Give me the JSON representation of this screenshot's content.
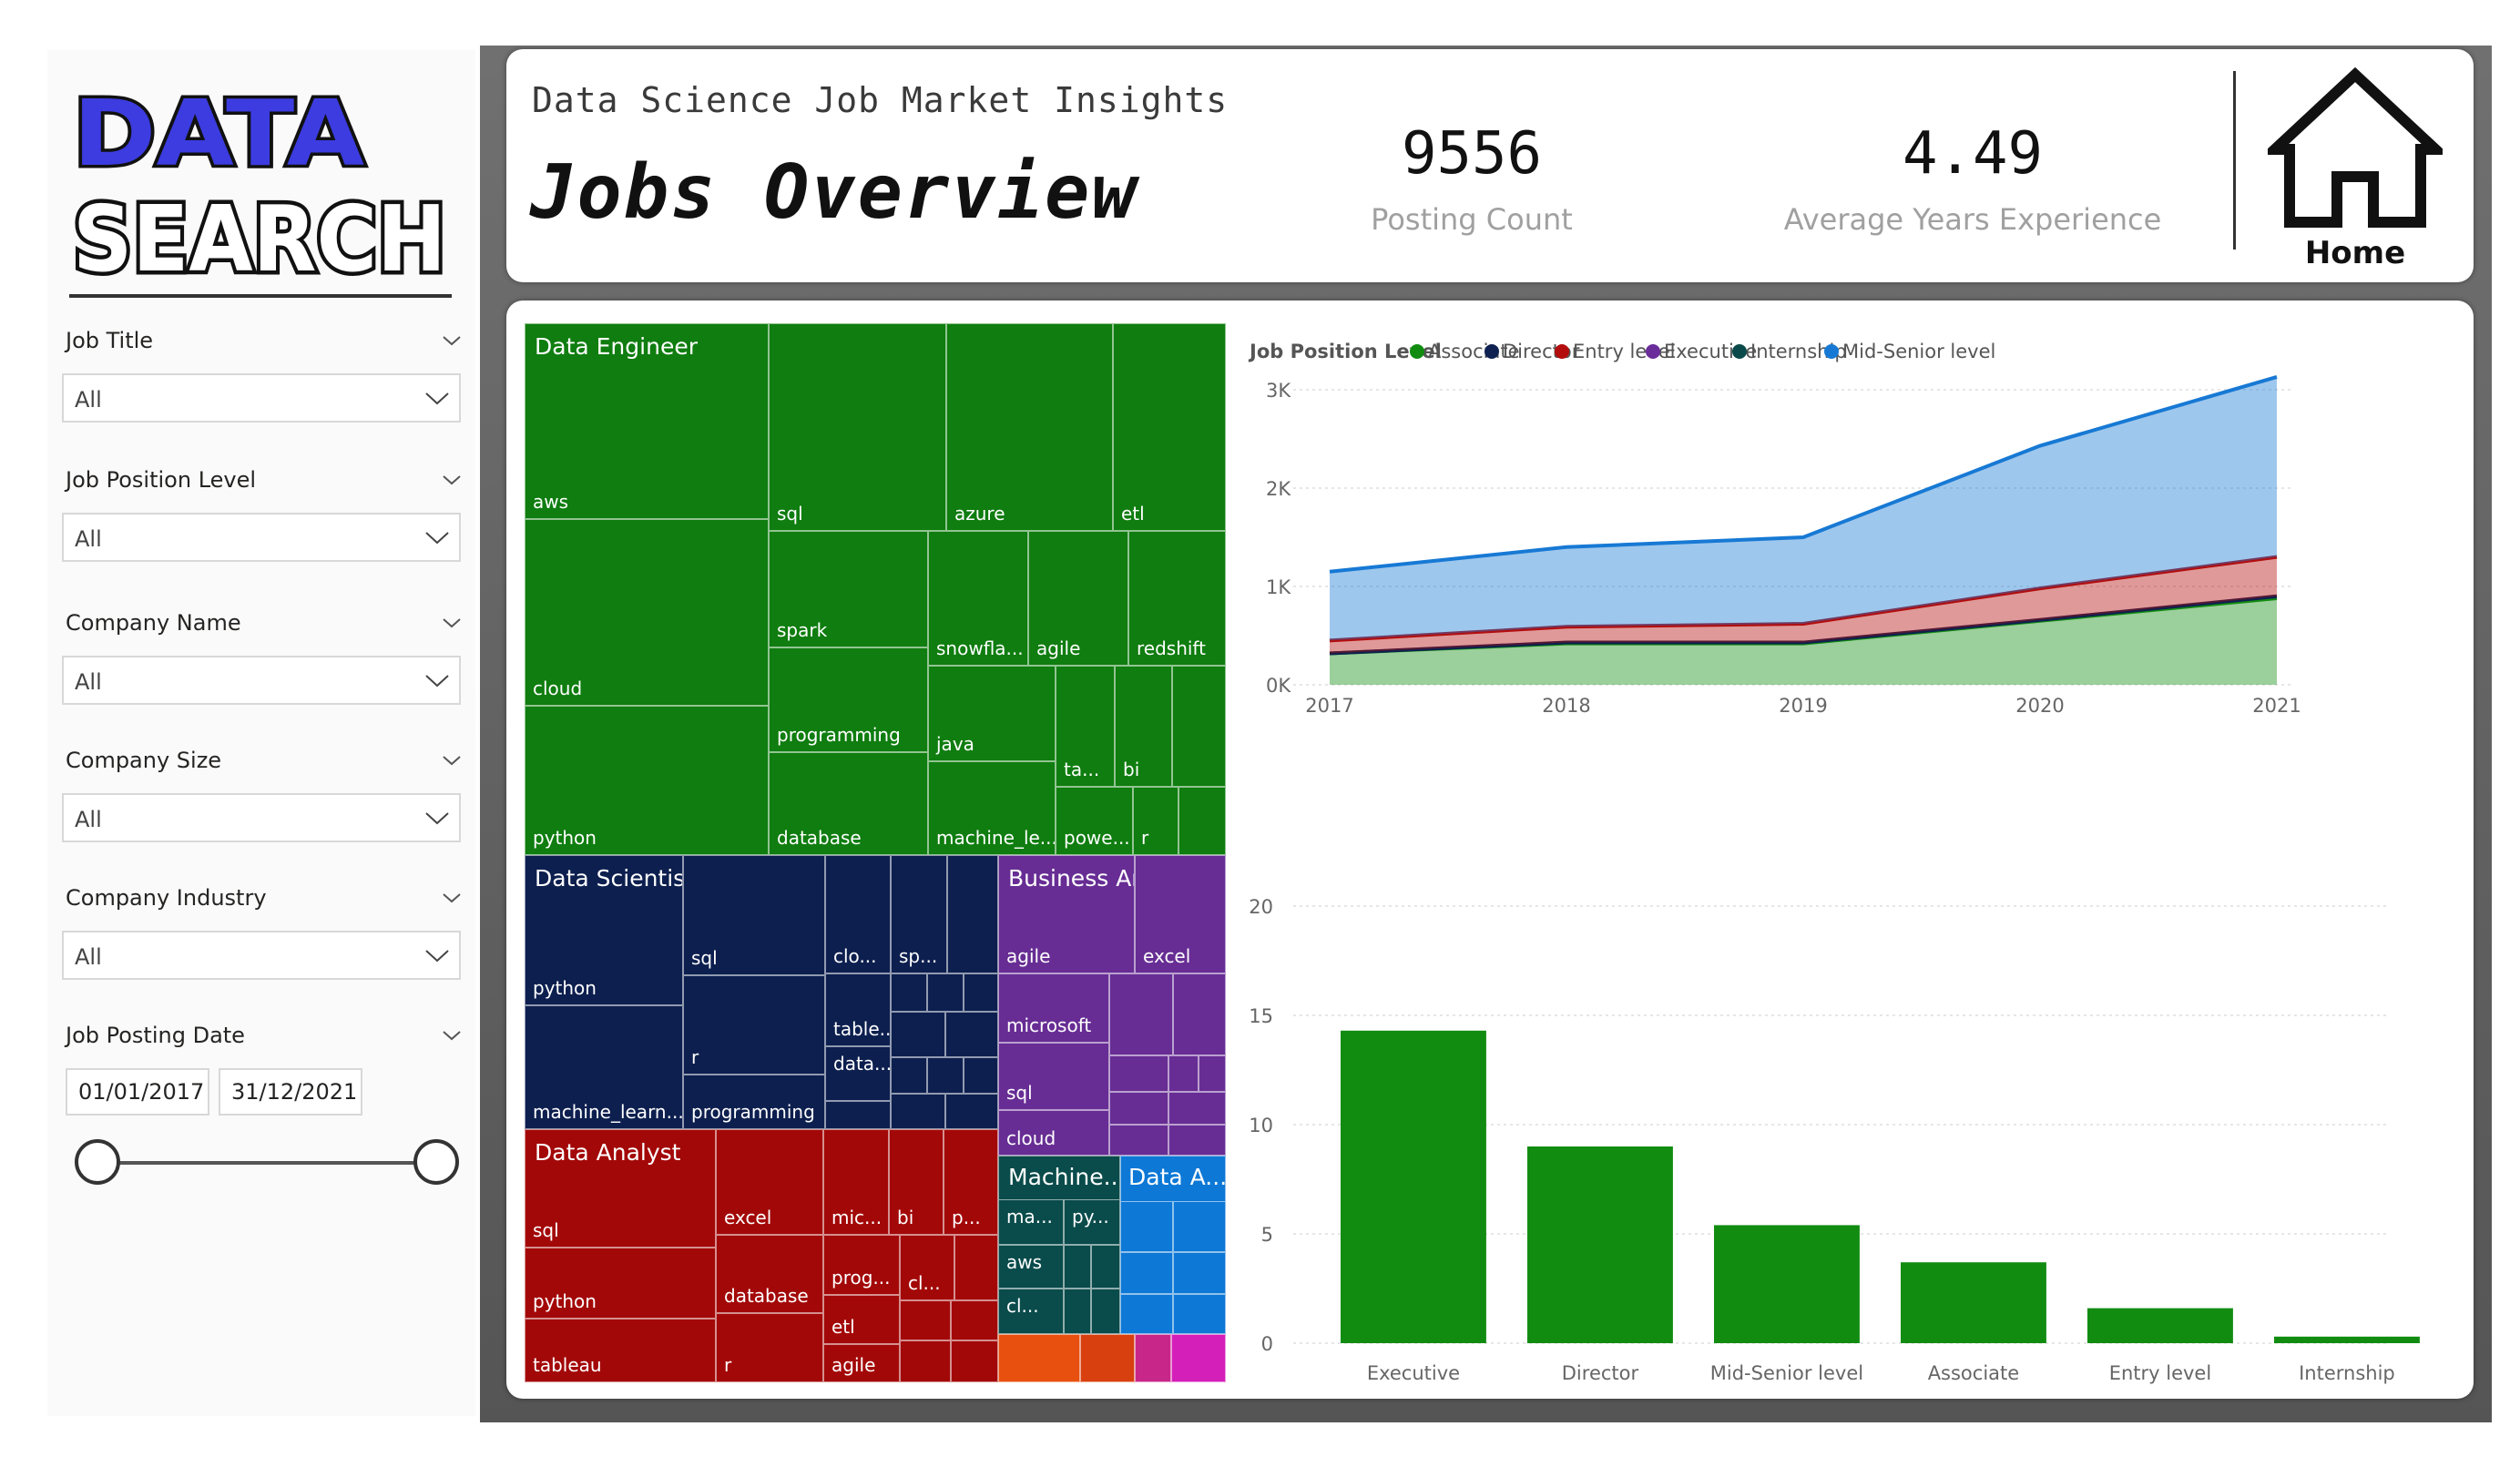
{
  "logo": {
    "line1": "DATA",
    "line2": "SEARCH"
  },
  "slicers": [
    {
      "label": "Job Title",
      "value": "All"
    },
    {
      "label": "Job Position Level",
      "value": "All"
    },
    {
      "label": "Company Name",
      "value": "All"
    },
    {
      "label": "Company Size",
      "value": "All"
    },
    {
      "label": "Company Industry",
      "value": "All"
    }
  ],
  "date_slicer": {
    "label": "Job Posting Date",
    "start": "01/01/2017",
    "end": "31/12/2021"
  },
  "header": {
    "subtitle": "Data Science Job Market Insights",
    "title": "Jobs Overview",
    "kpi1_value": "9556",
    "kpi1_label": "Posting Count",
    "kpi2_value": "4.49",
    "kpi2_label": "Average Years Experience",
    "home_label": "Home"
  },
  "colors": {
    "associate": "#118c11",
    "director": "#0e2150",
    "entry": "#b30d0d",
    "executive": "#6a2d9a",
    "internship": "#0b4a4a",
    "mid_senior": "#1779d4",
    "treemap_green": "#0f7d0f",
    "treemap_navy": "#0d1f4f",
    "treemap_purple": "#672d94",
    "treemap_red": "#a30808",
    "treemap_teal": "#0a4b4b",
    "treemap_blue": "#0d78d6"
  },
  "treemap": {
    "groups": [
      {
        "name": "Data Engineer",
        "items": [
          "aws",
          "cloud",
          "python",
          "sql",
          "azure",
          "etl",
          "spark",
          "snowfla...",
          "agile",
          "redshift",
          "programming",
          "java",
          "ta...",
          "bi",
          "database",
          "machine_le...",
          "powe...",
          "r"
        ]
      },
      {
        "name": "Data Scientist",
        "items": [
          "python",
          "machine_learn...",
          "sql",
          "r",
          "programming",
          "clo...",
          "sp...",
          "table...",
          "data..."
        ]
      },
      {
        "name": "Business Analyst",
        "items": [
          "agile",
          "excel",
          "microsoft",
          "sql",
          "cloud"
        ]
      },
      {
        "name": "Data Analyst",
        "items": [
          "sql",
          "python",
          "tableau",
          "excel",
          "database",
          "r",
          "mic...",
          "bi",
          "p...",
          "prog...",
          "cl...",
          "etl",
          "agile"
        ]
      },
      {
        "name": "Machine...",
        "items": [
          "ma...",
          "py...",
          "aws",
          "cl..."
        ]
      },
      {
        "name": "Data A...",
        "items": []
      }
    ]
  },
  "chart_data": [
    {
      "type": "area",
      "legend_title": "Job Position Level",
      "legend_placement": "top-left",
      "categories": [
        "2017",
        "2018",
        "2019",
        "2020",
        "2021"
      ],
      "stacked": true,
      "y_ticks": [
        "0K",
        "1K",
        "2K",
        "3K"
      ],
      "ylim": [
        0,
        3000
      ],
      "series": [
        {
          "name": "Associate",
          "values": [
            320,
            420,
            420,
            650,
            880
          ]
        },
        {
          "name": "Director",
          "values": [
            0,
            10,
            10,
            10,
            20
          ]
        },
        {
          "name": "Entry level",
          "values": [
            130,
            160,
            190,
            320,
            400
          ]
        },
        {
          "name": "Executive",
          "values": [
            0,
            0,
            0,
            0,
            0
          ]
        },
        {
          "name": "Internship",
          "values": [
            0,
            0,
            0,
            0,
            0
          ]
        },
        {
          "name": "Mid-Senior level",
          "values": [
            700,
            810,
            880,
            1450,
            1830
          ]
        }
      ]
    },
    {
      "type": "bar",
      "categories": [
        "Executive",
        "Director",
        "Mid-Senior level",
        "Associate",
        "Entry level",
        "Internship"
      ],
      "values": [
        14.3,
        9.0,
        5.4,
        3.7,
        1.6,
        0.3
      ],
      "y_ticks": [
        "0",
        "5",
        "10",
        "15",
        "20"
      ],
      "ylim": [
        0,
        20
      ],
      "grid": true
    }
  ]
}
